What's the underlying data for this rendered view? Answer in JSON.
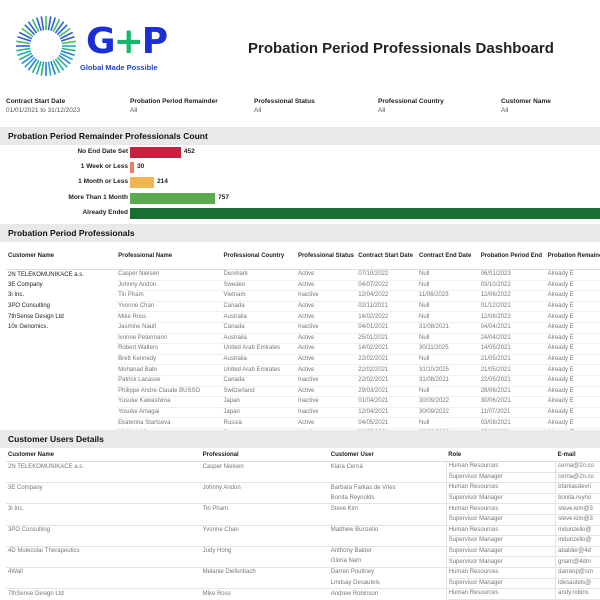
{
  "header": {
    "logo_text": "G+P",
    "logo_tagline": "Global Made Possible",
    "title": "Probation Period Professionals Dashboard"
  },
  "filters": [
    {
      "label": "Contract Start Date",
      "value": "01/01/2021 to 31/12/2023"
    },
    {
      "label": "Probation Period Remainder",
      "value": "All"
    },
    {
      "label": "Professional Status",
      "value": "All"
    },
    {
      "label": "Professional Country",
      "value": "All"
    },
    {
      "label": "Customer Name",
      "value": "All"
    }
  ],
  "sections": {
    "count_title": "Probation Period Remainder Professionals Count",
    "professionals_title": "Probation Period Professionals",
    "users_title": "Customer Users Details"
  },
  "chart_data": {
    "type": "bar",
    "orientation": "horizontal",
    "title": "Probation Period Remainder Professionals Count",
    "categories": [
      "No End Date Set",
      "1 Week or Less",
      "1 Month or Less",
      "More Than 1 Month",
      "Already Ended"
    ],
    "values": [
      452,
      30,
      214,
      757,
      null
    ],
    "value_labels": [
      "452",
      "30",
      "214",
      "757",
      ""
    ],
    "colors": [
      "#c8203f",
      "#ec7b62",
      "#f3b552",
      "#5aaa4e",
      "#1a6e34"
    ],
    "note": "Already Ended bar extends past the visible area"
  },
  "professionals_table": {
    "columns": [
      "Customer Name",
      "Professional Name",
      "Professional Country",
      "Professional Status",
      "Contract Start Date",
      "Contract End Date",
      "Probation Period End",
      "Probation Period Remainder"
    ],
    "column_labels_display": [
      "Customer Name",
      "Professional Name",
      "Professional Country",
      "Professional Status",
      "Contract Start Date",
      "Contract End Date",
      "Probation Period End",
      "Probation Remainde"
    ],
    "rows": [
      [
        "2N TELEKOMUNIKACE a.s.",
        "Casper Nielsen",
        "Denmark",
        "Active",
        "07/10/2022",
        "Null",
        "06/01/2023",
        "Already E"
      ],
      [
        "3E Company",
        "Johnny Andon",
        "Sweden",
        "Active",
        "04/07/2022",
        "Null",
        "03/10/2022",
        "Already E"
      ],
      [
        "3i Inc.",
        "Tin Pham",
        "Vietnam",
        "Inactive",
        "12/04/2022",
        "11/06/2023",
        "12/06/2022",
        "Already E"
      ],
      [
        "3PO Consulting",
        "Yvonne Chan",
        "Canada",
        "Active",
        "02/11/2021",
        "Null",
        "01/12/2021",
        "Already E"
      ],
      [
        "7thSense Design Ltd",
        "Mike Ross",
        "Australia",
        "Active",
        "14/02/2022",
        "Null",
        "12/08/2022",
        "Already E"
      ],
      [
        "10x Genomics.",
        "Jasmine Nault",
        "Canada",
        "Inactive",
        "04/01/2021",
        "31/08/2021",
        "04/04/2021",
        "Already E"
      ],
      [
        "",
        "Ivonne Petermann",
        "Australia",
        "Active",
        "25/01/2021",
        "Null",
        "24/04/2021",
        "Already E"
      ],
      [
        "",
        "Robert Walters",
        "United Arab Emirates",
        "Active",
        "14/02/2021",
        "30/11/2025",
        "14/05/2021",
        "Already E"
      ],
      [
        "",
        "Brett Kennedy",
        "Australia",
        "Active",
        "22/02/2021",
        "Null",
        "21/05/2021",
        "Already E"
      ],
      [
        "",
        "Mohanad Babi",
        "United Arab Emirates",
        "Active",
        "22/02/2021",
        "31/10/2025",
        "21/05/2021",
        "Already E"
      ],
      [
        "",
        "Patrick Lacasse",
        "Canada",
        "Inactive",
        "22/02/2021",
        "31/08/2021",
        "22/05/2021",
        "Already E"
      ],
      [
        "",
        "Philippe Andre Claude BUSSO",
        "Switzerland",
        "Active",
        "29/03/2021",
        "Null",
        "28/06/2021",
        "Already E"
      ],
      [
        "",
        "Yusuke Kawashima",
        "Japan",
        "Inactive",
        "01/04/2021",
        "30/09/2022",
        "30/06/2021",
        "Already E"
      ],
      [
        "",
        "Yosuke Amagai",
        "Japan",
        "Inactive",
        "12/04/2021",
        "30/09/2022",
        "11/07/2021",
        "Already E"
      ],
      [
        "",
        "Ekaterina Startseva",
        "Russia",
        "Active",
        "04/05/2021",
        "Null",
        "03/08/2021",
        "Already E"
      ],
      [
        "",
        "Kit Wan Ma",
        "Japan",
        "Inactive",
        "06/05/2021",
        "30/09/2022",
        "05/08/2021",
        "Already E"
      ]
    ]
  },
  "users_table": {
    "columns": [
      "Customer Name",
      "Professional",
      "Customer User",
      "Role",
      "E-mail"
    ],
    "rows": [
      [
        "2N TELEKOMUNIKACE a.s.",
        "Casper Nielsen",
        "Klára Cerná",
        "Human Resources",
        "cerna@2n.co"
      ],
      [
        "",
        "",
        "",
        "Supervisor Manager",
        "cerna@2n.co"
      ],
      [
        "3E Company",
        "Johnny Andon",
        "Barbara Farkas de Vries",
        "Human Resources",
        "bfarkasdevri"
      ],
      [
        "",
        "",
        "Bonita Reynolds",
        "Supervisor Manager",
        "bonita.reyno"
      ],
      [
        "3i Inc.",
        "Tin Pham",
        "Steve Kim",
        "Human Resources",
        "steve.kim@3"
      ],
      [
        "",
        "",
        "",
        "Supervisor Manager",
        "steve.kim@3"
      ],
      [
        "3PO Consulting",
        "Yvonne Chan",
        "Matthew Bunzello",
        "Human Resources",
        "mdunzello@"
      ],
      [
        "",
        "",
        "",
        "Supervisor Manager",
        "mdunzello@"
      ],
      [
        "4D Molecular Therapeutics",
        "Judy Hong",
        "Anthony Balder",
        "Supervisor Manager",
        "abalder@4d"
      ],
      [
        "",
        "",
        "Gloria Nam",
        "Supervisor Manager",
        "gnam@4dm"
      ],
      [
        "4Wall",
        "Melanie Diefenbach",
        "Darren Poultney",
        "Human Resources",
        "darrenp@sm"
      ],
      [
        "",
        "",
        "Lindsay Desautels",
        "Supervisor Manager",
        "ldesautels@"
      ],
      [
        "7thSense Design Ltd",
        "Mike Ross",
        "Andrew Robinson",
        "Human Resources",
        "andy.robins"
      ],
      [
        "",
        "",
        "Andy Shillingti",
        "Supervisor Manager",
        ""
      ]
    ]
  }
}
